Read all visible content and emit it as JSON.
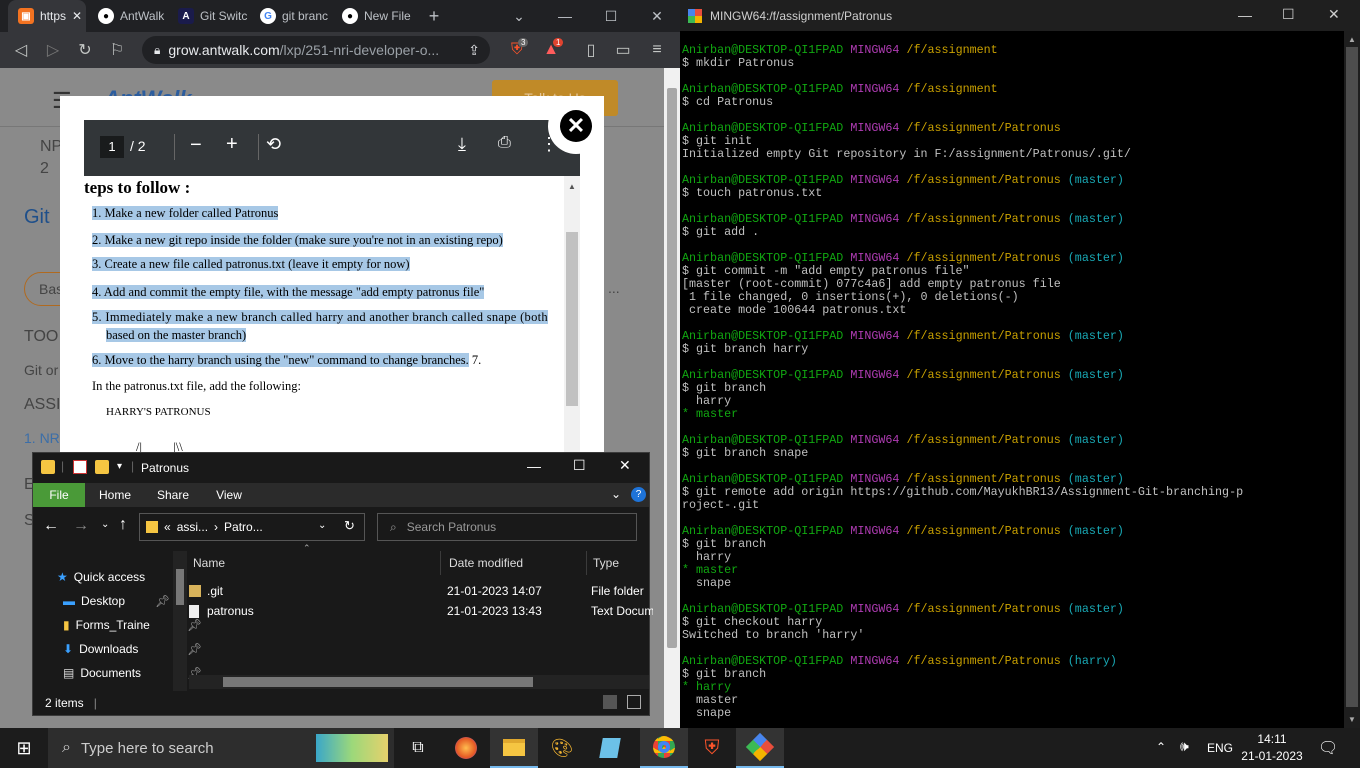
{
  "browser": {
    "tabs": [
      {
        "label": "https",
        "icon": "orange-logo-icon",
        "color": "#f37321"
      },
      {
        "label": "AntWalk",
        "icon": "github-icon",
        "color": "#ffffff"
      },
      {
        "label": "Git Switch",
        "icon": "logo-a-icon",
        "color": "#1a1b4b"
      },
      {
        "label": "git branc",
        "icon": "google-icon",
        "color": "#4285f4"
      },
      {
        "label": "New File",
        "icon": "github-icon",
        "color": "#ffffff"
      }
    ],
    "url_domain": "grow.antwalk.com",
    "url_path": "/lxp/251-nri-developer-o...",
    "brave_badge": "3",
    "alert_badge": "1",
    "page": {
      "logo": "AntWalk",
      "talk_btn": "Talk to Us",
      "np_label": "NP",
      "np_num": "2",
      "git_heading": "Git",
      "bas_btn": "Bas",
      "too_label": "TOO",
      "gitor_label": "Git or",
      "assi_label": "ASSI",
      "nr_link": "1. NR",
      "e_label": "E",
      "s_label": "S",
      "more": "..."
    },
    "pdf": {
      "page_current": "1",
      "page_total": "/ 2",
      "heading": "teps to follow :",
      "steps": [
        "1. Make a new folder called Patronus",
        "2. Make a new git repo inside the folder (make sure you're not in an existing repo)",
        "3. Create a new file called patronus.txt (leave it empty for now)",
        "4. Add and commit the empty file, with the message \"add empty patronus file\"",
        "5. Immediately make a new branch called harry and another branch called snape (both",
        "based on the master branch)",
        "6. Move to the harry branch using the \"new\" command to change branches.",
        "7.",
        "In the patronus.txt file, add the following:",
        "HARRY'S PATRONUS",
        "/|          |\\\\"
      ]
    }
  },
  "explorer": {
    "title": "Patronus",
    "ribbon": [
      "File",
      "Home",
      "Share",
      "View"
    ],
    "breadcrumb": [
      "«",
      "assi...",
      "›",
      "Patro..."
    ],
    "search_placeholder": "Search Patronus",
    "columns": [
      "Name",
      "Date modified",
      "Type"
    ],
    "nav": [
      {
        "label": "Quick access",
        "icon": "star-icon"
      },
      {
        "label": "Desktop",
        "icon": "desktop-icon"
      },
      {
        "label": "Forms_Traine",
        "icon": "folder-icon"
      },
      {
        "label": "Downloads",
        "icon": "download-icon"
      },
      {
        "label": "Documents",
        "icon": "documents-icon"
      }
    ],
    "files": [
      {
        "name": ".git",
        "date": "21-01-2023 14:07",
        "type": "File folder"
      },
      {
        "name": "patronus",
        "date": "21-01-2023 13:43",
        "type": "Text Docum"
      }
    ],
    "status": "2 items"
  },
  "terminal": {
    "title": "MINGW64:/f/assignment/Patronus",
    "user": "Anirban@DESKTOP-QI1FPAD",
    "host": "MINGW64",
    "blocks": [
      {
        "path": "/f/assignment",
        "branch": "",
        "cmd": "$ mkdir Patronus",
        "out": []
      },
      {
        "path": "/f/assignment",
        "branch": "",
        "cmd": "$ cd Patronus",
        "out": []
      },
      {
        "path": "/f/assignment/Patronus",
        "branch": "",
        "cmd": "$ git init",
        "out": [
          {
            "t": "Initialized empty Git repository in F:/assignment/Patronus/.git/",
            "c": ""
          }
        ]
      },
      {
        "path": "/f/assignment/Patronus",
        "branch": "(master)",
        "cmd": "$ touch patronus.txt",
        "out": []
      },
      {
        "path": "/f/assignment/Patronus",
        "branch": "(master)",
        "cmd": "$ git add .",
        "out": []
      },
      {
        "path": "/f/assignment/Patronus",
        "branch": "(master)",
        "cmd": "$ git commit -m \"add empty patronus file\"",
        "out": [
          {
            "t": "[master (root-commit) 077c4a6] add empty patronus file",
            "c": ""
          },
          {
            "t": " 1 file changed, 0 insertions(+), 0 deletions(-)",
            "c": ""
          },
          {
            "t": " create mode 100644 patronus.txt",
            "c": ""
          }
        ]
      },
      {
        "path": "/f/assignment/Patronus",
        "branch": "(master)",
        "cmd": "$ git branch harry",
        "out": []
      },
      {
        "path": "/f/assignment/Patronus",
        "branch": "(master)",
        "cmd": "$ git branch",
        "out": [
          {
            "t": "  harry",
            "c": ""
          },
          {
            "t": "* master",
            "c": "g"
          }
        ]
      },
      {
        "path": "/f/assignment/Patronus",
        "branch": "(master)",
        "cmd": "$ git branch snape",
        "out": []
      },
      {
        "path": "/f/assignment/Patronus",
        "branch": "(master)",
        "cmd": "$ git remote add origin https://github.com/MayukhBR13/Assignment-Git-branching-p",
        "out": [
          {
            "t": "roject-.git",
            "c": ""
          }
        ]
      },
      {
        "path": "/f/assignment/Patronus",
        "branch": "(master)",
        "cmd": "$ git branch",
        "out": [
          {
            "t": "  harry",
            "c": ""
          },
          {
            "t": "* master",
            "c": "g"
          },
          {
            "t": "  snape",
            "c": ""
          }
        ]
      },
      {
        "path": "/f/assignment/Patronus",
        "branch": "(master)",
        "cmd": "$ git checkout harry",
        "out": [
          {
            "t": "Switched to branch 'harry'",
            "c": ""
          }
        ]
      },
      {
        "path": "/f/assignment/Patronus",
        "branch": "(harry)",
        "cmd": "$ git branch",
        "out": [
          {
            "t": "* harry",
            "c": "g"
          },
          {
            "t": "  master",
            "c": ""
          },
          {
            "t": "  snape",
            "c": ""
          }
        ]
      }
    ]
  },
  "taskbar": {
    "search_placeholder": "Type here to search",
    "lang": "ENG",
    "time": "14:11",
    "date": "21-01-2023"
  }
}
